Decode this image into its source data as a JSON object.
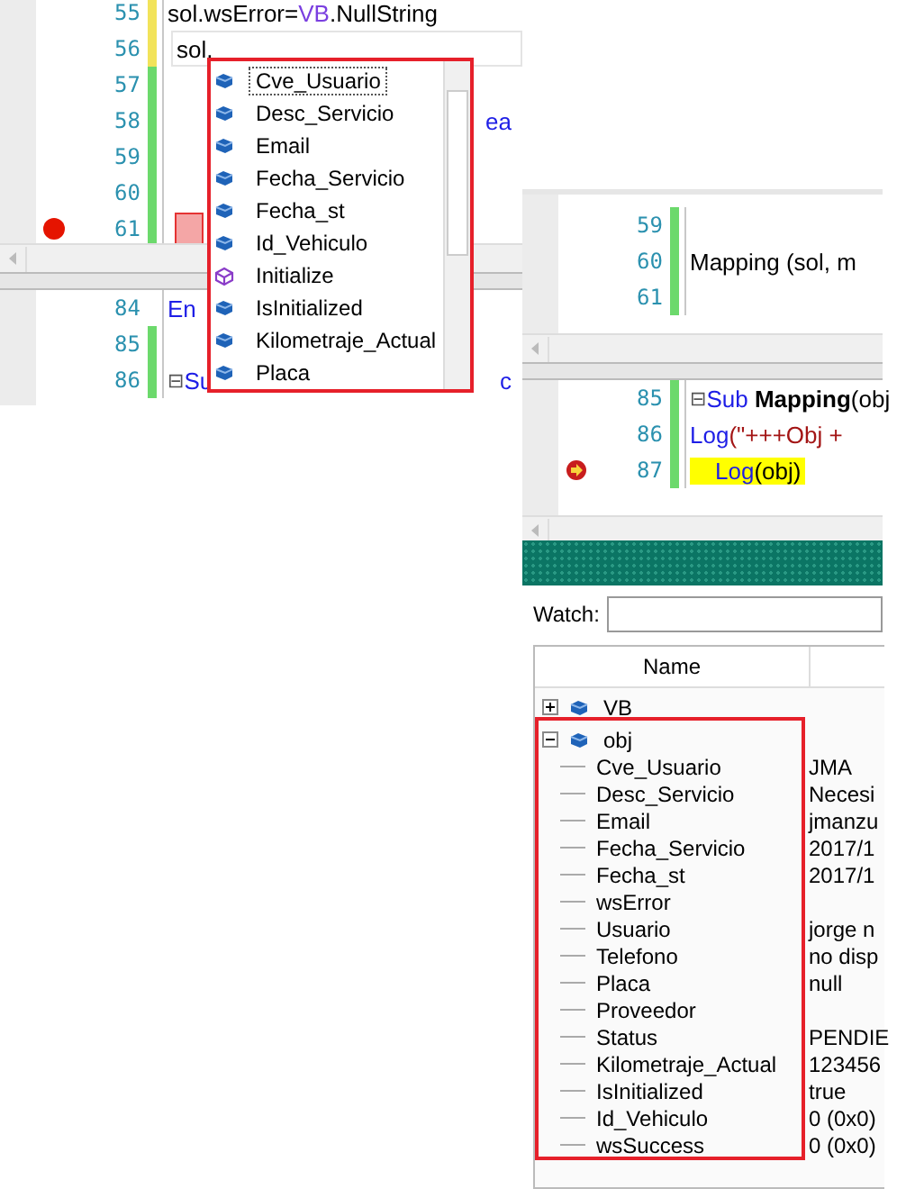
{
  "left_editor": {
    "top_lines": [
      {
        "number": "55",
        "color": "#f2e35a",
        "breakpoint": false,
        "tokens": [
          {
            "text": "sol.wsError=",
            "kind": "plain"
          },
          {
            "text": "VB",
            "kind": "type"
          },
          {
            "text": ".NullString",
            "kind": "plain"
          }
        ]
      },
      {
        "number": "56",
        "color": "#f2e35a",
        "breakpoint": false,
        "current": true,
        "tokens": [
          {
            "text": "sol.",
            "kind": "plain"
          }
        ]
      },
      {
        "number": "57",
        "color": "#6cd96c",
        "breakpoint": false
      },
      {
        "number": "58",
        "color": "#6cd96c",
        "breakpoint": false,
        "tokens": [
          {
            "text": "ea",
            "kind": "fragment"
          }
        ]
      },
      {
        "number": "59",
        "color": "#6cd96c",
        "breakpoint": false
      },
      {
        "number": "60",
        "color": "#6cd96c",
        "breakpoint": false
      },
      {
        "number": "61",
        "color": "#6cd96c",
        "breakpoint": true
      }
    ],
    "bottom_lines": [
      {
        "number": "84",
        "tokens": [
          {
            "text": "En",
            "kind": "keyword"
          }
        ]
      },
      {
        "number": "85",
        "color": "#6cd96c"
      },
      {
        "number": "86",
        "color": "#6cd96c",
        "fold": "⊟",
        "tokens": [
          {
            "text": "Su",
            "kind": "keyword"
          },
          {
            "text": "c",
            "kind": "fragment"
          }
        ]
      }
    ],
    "autocomplete": [
      {
        "label": "Cve_Usuario",
        "kind": "property",
        "selected": true
      },
      {
        "label": "Desc_Servicio",
        "kind": "property",
        "selected": false
      },
      {
        "label": "Email",
        "kind": "property",
        "selected": false
      },
      {
        "label": "Fecha_Servicio",
        "kind": "property",
        "selected": false
      },
      {
        "label": "Fecha_st",
        "kind": "property",
        "selected": false
      },
      {
        "label": "Id_Vehiculo",
        "kind": "property",
        "selected": false
      },
      {
        "label": "Initialize",
        "kind": "method",
        "selected": false
      },
      {
        "label": "IsInitialized",
        "kind": "property",
        "selected": false
      },
      {
        "label": "Kilometraje_Actual",
        "kind": "property",
        "selected": false
      },
      {
        "label": "Placa",
        "kind": "property",
        "selected": false
      }
    ]
  },
  "right_editor": {
    "top_lines": [
      {
        "number": "59",
        "color": "#6cd96c"
      },
      {
        "number": "60",
        "color": "#6cd96c",
        "tokens": [
          {
            "text": "Mapping (sol, m",
            "kind": "plain"
          }
        ]
      },
      {
        "number": "61",
        "color": "#6cd96c"
      }
    ],
    "bottom_lines": [
      {
        "number": "85",
        "color": "#6cd96c",
        "fold": "⊟",
        "tokens": [
          {
            "text": "Sub ",
            "kind": "keyword"
          },
          {
            "text": "Mapping",
            "kind": "bold"
          },
          {
            "text": "(obj",
            "kind": "plain"
          }
        ]
      },
      {
        "number": "86",
        "color": "#6cd96c",
        "tokens": [
          {
            "text": "Log",
            "kind": "keyword"
          },
          {
            "text": "(\"+++Obj +",
            "kind": "string"
          }
        ]
      },
      {
        "number": "87",
        "color": "#6cd96c",
        "current": true,
        "tokens": [
          {
            "text": "Log",
            "kind": "keyword"
          },
          {
            "text": "(obj)",
            "kind": "plain"
          }
        ]
      }
    ]
  },
  "watch": {
    "label": "Watch:",
    "column": "Name",
    "items": [
      {
        "name": "VB",
        "expanded": false
      },
      {
        "name": "obj",
        "expanded": true,
        "children": [
          {
            "name": "Cve_Usuario",
            "value": "JMA"
          },
          {
            "name": "Desc_Servicio",
            "value": "Necesi"
          },
          {
            "name": "Email",
            "value": "jmanzu"
          },
          {
            "name": "Fecha_Servicio",
            "value": "2017/1"
          },
          {
            "name": "Fecha_st",
            "value": "2017/1"
          },
          {
            "name": "wsError"
          },
          {
            "name": "Usuario",
            "value": "jorge n"
          },
          {
            "name": "Telefono",
            "value": "no disp"
          },
          {
            "name": "Placa",
            "value": "null"
          },
          {
            "name": "Proveedor"
          },
          {
            "name": "Status",
            "value": "PENDIE"
          },
          {
            "name": "Kilometraje_Actual",
            "value": "123456"
          },
          {
            "name": "IsInitialized",
            "value": "true"
          },
          {
            "name": "Id_Vehiculo",
            "value": "0 (0x0)"
          },
          {
            "name": "wsSuccess",
            "value": "0 (0x0)"
          }
        ]
      }
    ]
  }
}
